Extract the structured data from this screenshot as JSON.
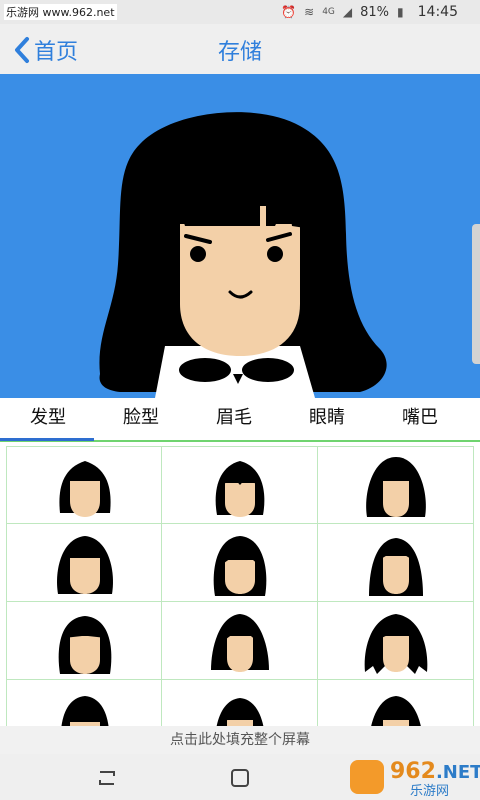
{
  "status_bar": {
    "watermark_text": "乐游网 www.962.net",
    "battery": "81%",
    "time": "14:45",
    "network": "4G",
    "icons": [
      "alarm-icon",
      "wifi-icon",
      "signal-icon",
      "battery-icon"
    ]
  },
  "app_bar": {
    "back_label": "首页",
    "title": "存储",
    "accent_color": "#2f7fdc"
  },
  "preview": {
    "background_color": "#3a8ee6"
  },
  "tabs": [
    {
      "label": "发型",
      "selected": true
    },
    {
      "label": "脸型",
      "selected": false
    },
    {
      "label": "眉毛",
      "selected": false
    },
    {
      "label": "眼睛",
      "selected": false
    },
    {
      "label": "嘴巴",
      "selected": false
    }
  ],
  "hair_grid": {
    "item_count": 12,
    "items": [
      "hairstyle-1",
      "hairstyle-2",
      "hairstyle-3",
      "hairstyle-4",
      "hairstyle-5",
      "hairstyle-6",
      "hairstyle-7",
      "hairstyle-8",
      "hairstyle-9",
      "hairstyle-10",
      "hairstyle-11",
      "hairstyle-12"
    ]
  },
  "fill_screen": {
    "label": "点击此处填充整个屏幕"
  },
  "nav_bar": {
    "icons": [
      "recent-apps-icon",
      "home-icon"
    ],
    "logo_number": "962",
    "logo_suffix": ".NET",
    "logo_subtitle": "乐游网"
  }
}
